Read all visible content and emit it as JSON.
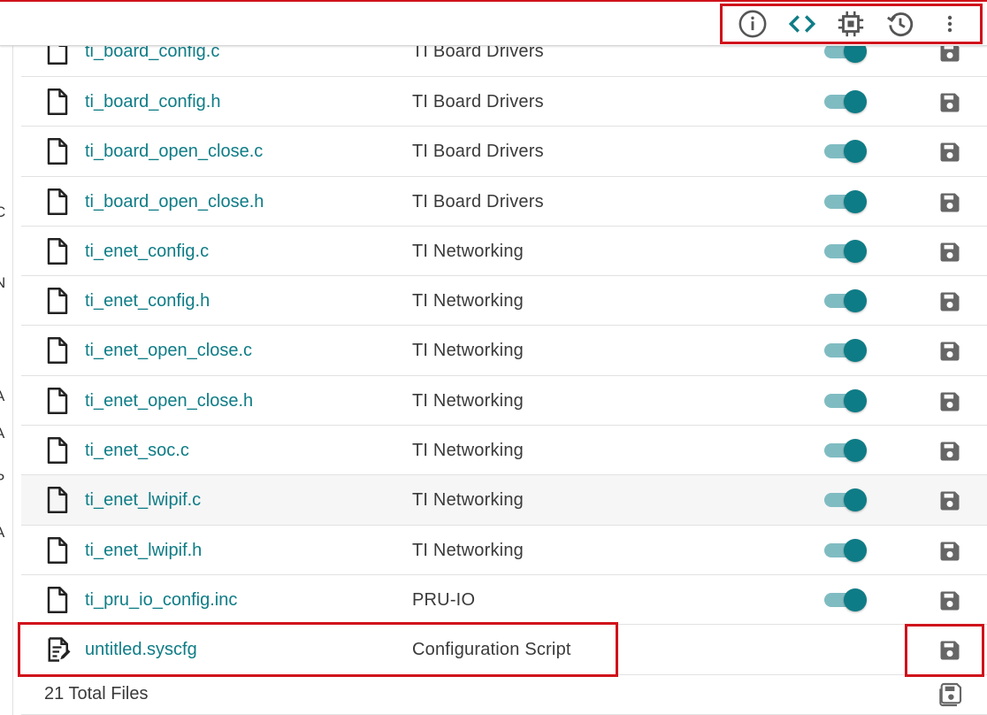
{
  "toolbar": {
    "icons": [
      "info-icon",
      "code-icon",
      "chip-icon",
      "history-icon",
      "more-vert-icon"
    ],
    "accent": "#0e7c86"
  },
  "files": [
    {
      "name": "ti_board_config.c",
      "category": "TI Board Drivers",
      "enabled": true
    },
    {
      "name": "ti_board_config.h",
      "category": "TI Board Drivers",
      "enabled": true
    },
    {
      "name": "ti_board_open_close.c",
      "category": "TI Board Drivers",
      "enabled": true
    },
    {
      "name": "ti_board_open_close.h",
      "category": "TI Board Drivers",
      "enabled": true
    },
    {
      "name": "ti_enet_config.c",
      "category": "TI Networking",
      "enabled": true
    },
    {
      "name": "ti_enet_config.h",
      "category": "TI Networking",
      "enabled": true
    },
    {
      "name": "ti_enet_open_close.c",
      "category": "TI Networking",
      "enabled": true
    },
    {
      "name": "ti_enet_open_close.h",
      "category": "TI Networking",
      "enabled": true
    },
    {
      "name": "ti_enet_soc.c",
      "category": "TI Networking",
      "enabled": true
    },
    {
      "name": "ti_enet_lwipif.c",
      "category": "TI Networking",
      "enabled": true
    },
    {
      "name": "ti_enet_lwipif.h",
      "category": "TI Networking",
      "enabled": true
    },
    {
      "name": "ti_pru_io_config.inc",
      "category": "PRU-IO",
      "enabled": true
    },
    {
      "name": "untitled.syscfg",
      "category": "Configuration Script",
      "enabled": null
    }
  ],
  "footer": {
    "total_label": "21 Total Files"
  },
  "colors": {
    "link": "#0e7c86",
    "highlight": "#d0121b",
    "icon_gray": "#666666"
  }
}
